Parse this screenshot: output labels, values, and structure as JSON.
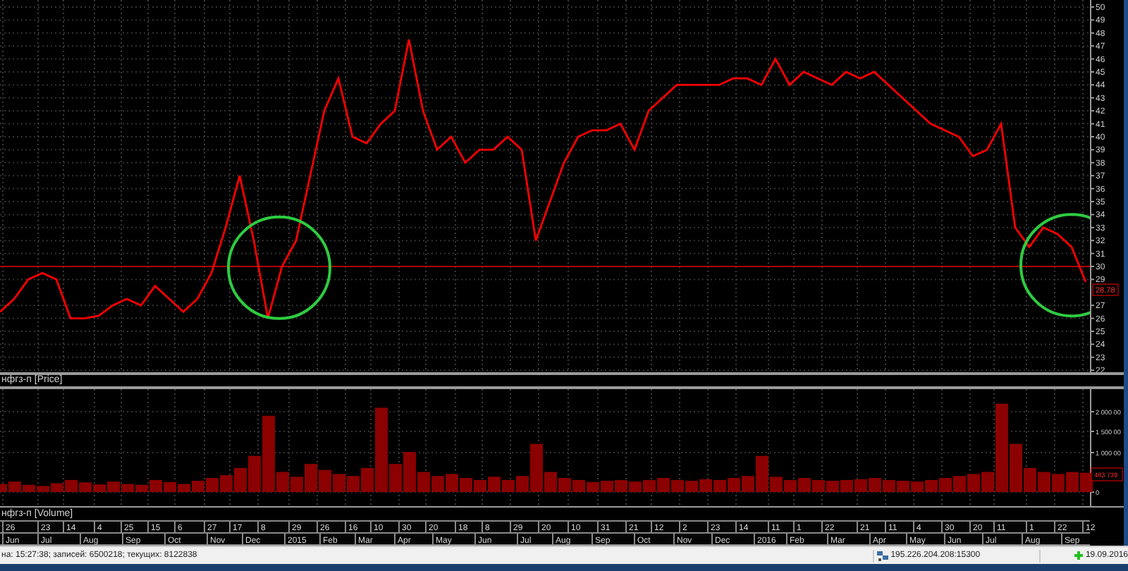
{
  "price_panel": {
    "label": "нфгз-п [Price]",
    "last_value": "28.78",
    "chart_data": {
      "type": "line",
      "grid": true,
      "ylim": [
        22,
        50
      ],
      "yticks": [
        22,
        23,
        24,
        25,
        26,
        27,
        29,
        30,
        31,
        32,
        33,
        34,
        35,
        36,
        37,
        38,
        39,
        40,
        41,
        42,
        43,
        44,
        45,
        46,
        47,
        48,
        49,
        50
      ],
      "series": [
        {
          "color": "#ff0000",
          "values": [
            26.5,
            27.5,
            29,
            29.5,
            29,
            26,
            26,
            26.2,
            27,
            27.5,
            27,
            28.5,
            27.5,
            26.5,
            27.5,
            29.5,
            33,
            37,
            32,
            26,
            30,
            32,
            37,
            42,
            44.5,
            40,
            39.5,
            41,
            42,
            47.5,
            42,
            39,
            40,
            38,
            39,
            39,
            40,
            39,
            32,
            35,
            38,
            40,
            40.5,
            40.5,
            41,
            39,
            42,
            43,
            44,
            44,
            44,
            44,
            44.5,
            44.5,
            44,
            46,
            44,
            45,
            44.5,
            44,
            45,
            44.5,
            45,
            44,
            43,
            42,
            41,
            40.5,
            40,
            38.5,
            39,
            41,
            33,
            31.5,
            33,
            32.5,
            31.5,
            28.8
          ]
        }
      ],
      "ref_lines": [
        {
          "value": 30,
          "axis": "y"
        }
      ]
    }
  },
  "volume_panel": {
    "label": "нфгз-п [Volume]",
    "last_value": "483 739",
    "axis_labels": [
      "2 000 00",
      "1 500 00",
      "1 000 00",
      "0"
    ]
  },
  "date_axis": {
    "days": [
      "26",
      "23",
      "14",
      "4",
      "25",
      "15",
      "6",
      "27",
      "17",
      "8",
      "29",
      "26",
      "16",
      "10",
      "30",
      "20",
      "18",
      "8",
      "29",
      "20",
      "10",
      "31",
      "21",
      "12",
      "2",
      "23",
      "14",
      "11",
      "1",
      "22",
      "21",
      "11",
      "4",
      "30",
      "20",
      "11",
      "1",
      "22",
      "12"
    ],
    "months": [
      "Jun",
      "Jul",
      "Aug",
      "Sep",
      "Oct",
      "Nov",
      "Dec",
      "2015",
      "Feb",
      "Mar",
      "Apr",
      "May",
      "Jun",
      "Jul",
      "Aug",
      "Sep",
      "Oct",
      "Nov",
      "Dec",
      "2016",
      "Feb",
      "Mar",
      "Apr",
      "May",
      "Jun",
      "Jul",
      "Aug",
      "Sep"
    ]
  },
  "status_bar": {
    "info": "на: 15:27:38; записей: 6500218; текущих: 8122838",
    "server": "195.226.204.208:15300",
    "date": "19.09.2016"
  }
}
